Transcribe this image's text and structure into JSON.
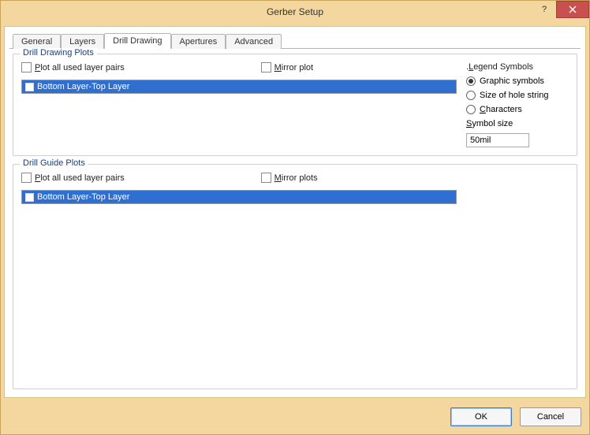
{
  "window": {
    "title": "Gerber Setup"
  },
  "tabs": {
    "items": [
      {
        "label": "General"
      },
      {
        "label": "Layers"
      },
      {
        "label": "Drill Drawing"
      },
      {
        "label": "Apertures"
      },
      {
        "label": "Advanced"
      }
    ],
    "active_index": 2
  },
  "drill_drawing": {
    "legend": "Drill Drawing Plots",
    "plot_all_label": "Plot all used layer pairs",
    "mirror_label": "Mirror plot",
    "list": [
      {
        "label": "Bottom Layer-Top Layer",
        "checked": false,
        "selected": true
      }
    ],
    "legend_symbols": {
      "heading": "Legend Symbols",
      "options": [
        {
          "label": "Graphic symbols",
          "selected": true
        },
        {
          "label": "Size of hole string",
          "selected": false
        },
        {
          "label": "Characters",
          "selected": false
        }
      ],
      "symbol_size_label": "Symbol size",
      "symbol_size_value": "50mil"
    }
  },
  "drill_guide": {
    "legend": "Drill Guide Plots",
    "plot_all_label": "Plot all used layer pairs",
    "mirror_label": "Mirror plots",
    "list": [
      {
        "label": "Bottom Layer-Top Layer",
        "checked": false,
        "selected": true
      }
    ]
  },
  "buttons": {
    "ok": "OK",
    "cancel": "Cancel"
  }
}
